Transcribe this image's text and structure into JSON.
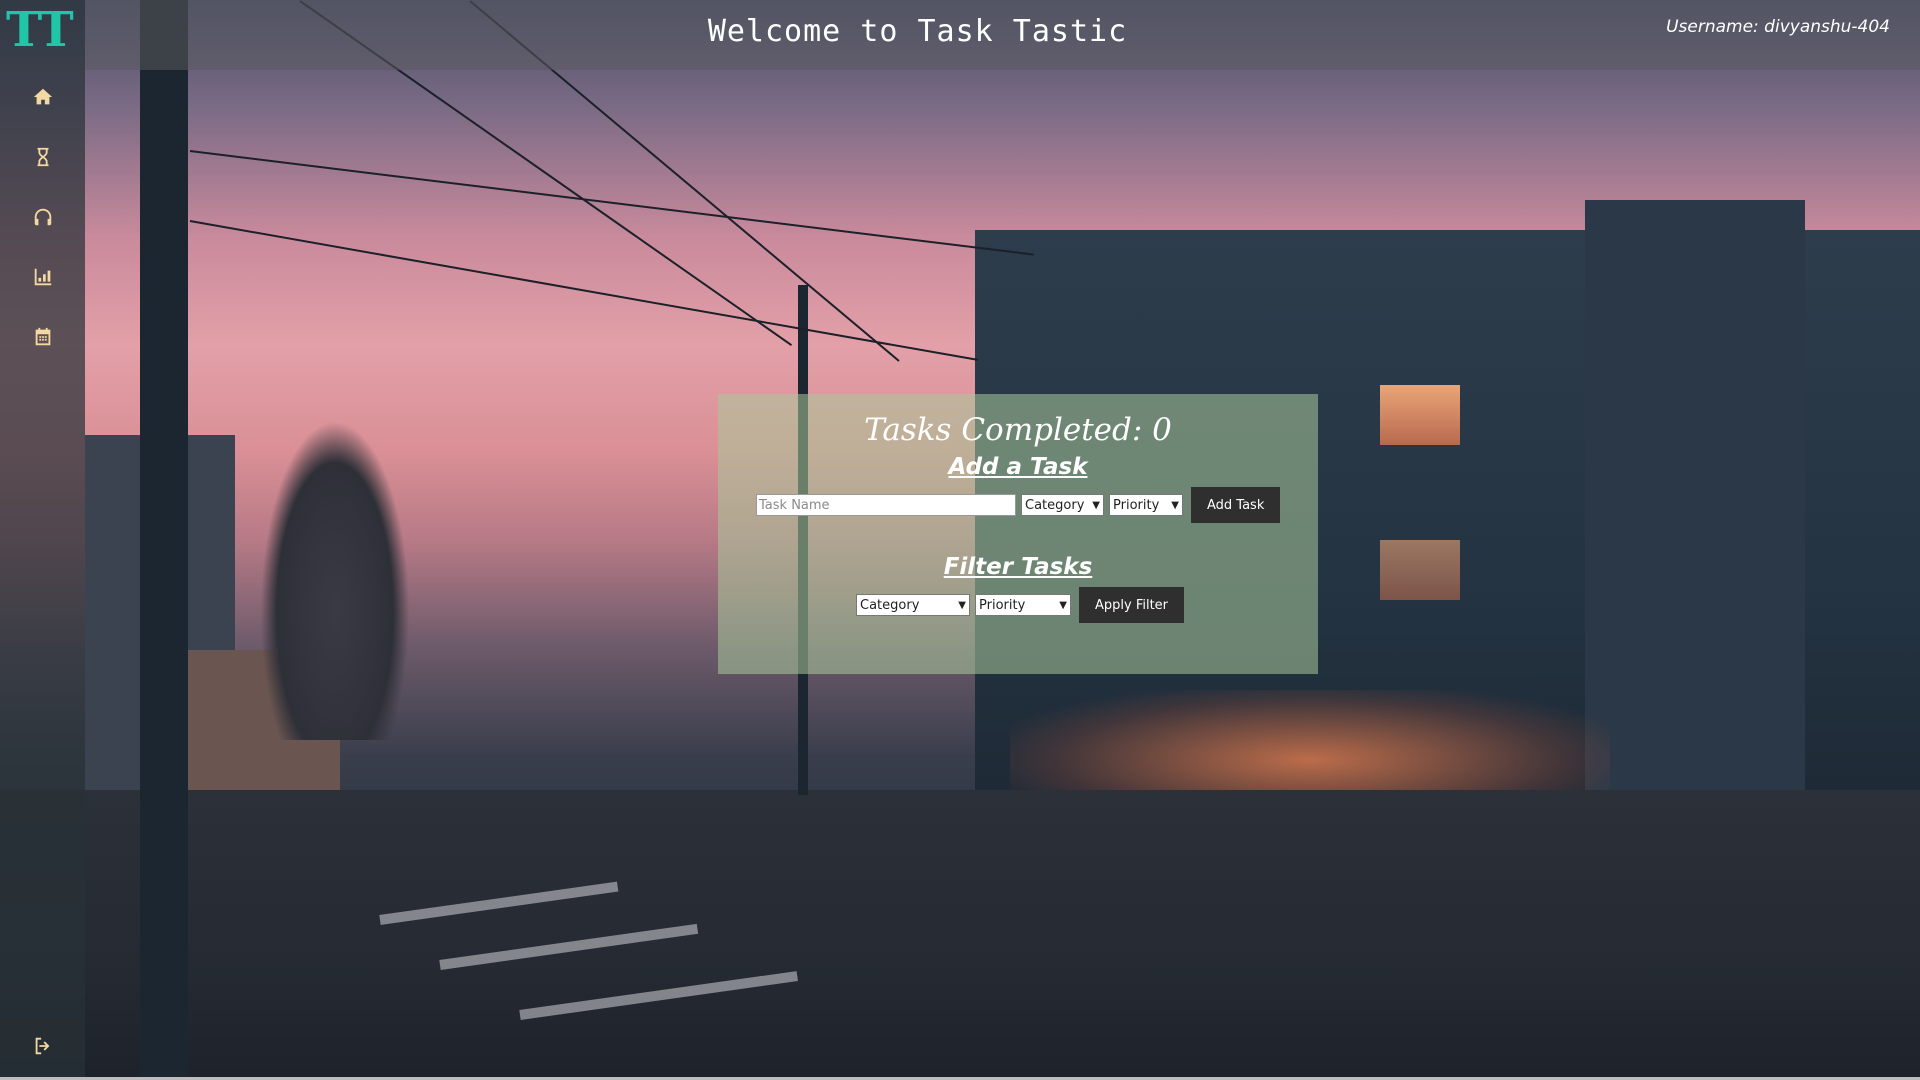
{
  "app": {
    "logo": "TT",
    "title": "Welcome to Task Tastic",
    "username_text": "Username: divyanshu-404"
  },
  "sidebar": {
    "items": [
      {
        "icon": "home-icon"
      },
      {
        "icon": "hourglass-icon"
      },
      {
        "icon": "headphones-icon"
      },
      {
        "icon": "chart-icon"
      },
      {
        "icon": "calendar-icon"
      }
    ],
    "footer_icon": "logout-icon"
  },
  "tasks": {
    "completed_text": "Tasks Completed: 0",
    "add_heading": "Add a Task",
    "task_name_placeholder": "Task Name",
    "task_name_value": "",
    "category_selected": "Category",
    "priority_selected": "Priority",
    "add_button": "Add Task",
    "filter_heading": "Filter Tasks",
    "filter_category_selected": "Category",
    "filter_priority_selected": "Priority",
    "filter_button": "Apply Filter"
  },
  "colors": {
    "logo": "#1fc6a8",
    "sidebar_icons": "#f3d8a2",
    "button_bg": "#2f2f2f"
  }
}
